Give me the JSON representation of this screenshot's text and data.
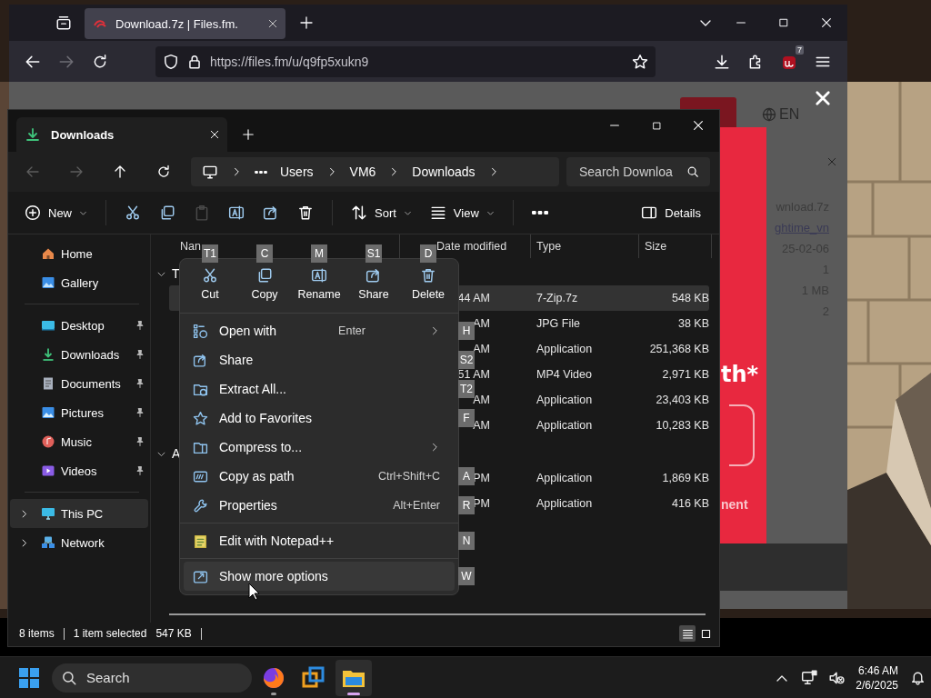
{
  "browser": {
    "tabs": [
      {
        "title": "Download.7z | Files.fm.",
        "selected": true
      }
    ],
    "url": "https://files.fm/u/q9fp5xukn9",
    "extension_badge": "7",
    "page": {
      "language": "EN",
      "popup_heading": "th*",
      "popup_link": "nent",
      "file_details": [
        "wnload.7z",
        "ghtime_vn",
        "25-02-06",
        "1",
        "1 MB",
        "2"
      ]
    }
  },
  "explorer": {
    "tabs": [
      {
        "title": "Downloads",
        "selected": true
      }
    ],
    "breadcrumb": [
      "Users",
      "VM6",
      "Downloads"
    ],
    "search": {
      "placeholder": "Search Downloa"
    },
    "toolbar": [
      {
        "kind": "new",
        "label": "New",
        "disabled": false
      },
      {
        "kind": "cut",
        "disabled": false
      },
      {
        "kind": "copy",
        "disabled": false
      },
      {
        "kind": "paste",
        "disabled": true
      },
      {
        "kind": "rename",
        "disabled": false
      },
      {
        "kind": "share",
        "disabled": false
      },
      {
        "kind": "delete",
        "disabled": false
      },
      {
        "kind": "sort",
        "label": "Sort",
        "disabled": false
      },
      {
        "kind": "view",
        "label": "View",
        "disabled": false
      },
      {
        "kind": "more",
        "disabled": false
      }
    ],
    "details_button": "Details",
    "sidebar": [
      [
        {
          "label": "Home",
          "pinned": false,
          "expandable": false,
          "selected": false
        },
        {
          "label": "Gallery",
          "pinned": false,
          "expandable": false,
          "selected": false
        }
      ],
      [
        {
          "label": "Desktop",
          "pinned": true,
          "expandable": false,
          "selected": false
        },
        {
          "label": "Downloads",
          "pinned": true,
          "expandable": false,
          "selected": false
        },
        {
          "label": "Documents",
          "pinned": true,
          "expandable": false,
          "selected": false
        },
        {
          "label": "Pictures",
          "pinned": true,
          "expandable": false,
          "selected": false
        },
        {
          "label": "Music",
          "pinned": true,
          "expandable": false,
          "selected": false
        },
        {
          "label": "Videos",
          "pinned": true,
          "expandable": false,
          "selected": false
        }
      ],
      [
        {
          "label": "This PC",
          "pinned": false,
          "expandable": true,
          "selected": true
        },
        {
          "label": "Network",
          "pinned": false,
          "expandable": true,
          "selected": false
        }
      ]
    ],
    "columns": [
      "Nan",
      "Date modified",
      "Type",
      "Size"
    ],
    "groups": [
      {
        "label": "T",
        "expanded": true,
        "rows": [
          {
            "date": "44 AM",
            "type": "7-Zip.7z",
            "size": "548 KB",
            "selected": true
          },
          {
            "date": "AM",
            "type": "JPG File",
            "size": "38 KB",
            "selected": false
          },
          {
            "date": "AM",
            "type": "Application",
            "size": "251,368 KB",
            "selected": false
          },
          {
            "date": "51 AM",
            "type": "MP4 Video",
            "size": "2,971 KB",
            "selected": false
          },
          {
            "date": "AM",
            "type": "Application",
            "size": "23,403 KB",
            "selected": false
          },
          {
            "date": "AM",
            "type": "Application",
            "size": "10,283 KB",
            "selected": false
          }
        ]
      },
      {
        "label": "A",
        "expanded": true,
        "rows": [
          {
            "date": "PM",
            "type": "Application",
            "size": "1,869 KB",
            "selected": false
          },
          {
            "date": "PM",
            "type": "Application",
            "size": "416 KB",
            "selected": false
          }
        ]
      }
    ],
    "status": {
      "item_count": "8 items",
      "selection": "1 item selected",
      "selection_size": "547 KB"
    },
    "views": [
      {
        "kind": "details",
        "selected": true
      },
      {
        "kind": "tiles",
        "selected": false
      }
    ]
  },
  "context_menu": {
    "actions": [
      {
        "label": "Cut",
        "access_key": "T1"
      },
      {
        "label": "Copy",
        "access_key": "C"
      },
      {
        "label": "Rename",
        "access_key": "M"
      },
      {
        "label": "Share",
        "access_key": "S1"
      },
      {
        "label": "Delete",
        "access_key": "D"
      }
    ],
    "items": [
      {
        "kind": "item",
        "label": "Open with",
        "shortcut": "Enter",
        "submenu": true,
        "access_key": "H",
        "selected": false
      },
      {
        "kind": "item",
        "label": "Share",
        "submenu": false,
        "access_key": "S2",
        "selected": false
      },
      {
        "kind": "item",
        "label": "Extract All...",
        "submenu": false,
        "access_key": "T2",
        "selected": false
      },
      {
        "kind": "item",
        "label": "Add to Favorites",
        "submenu": false,
        "access_key": "F",
        "selected": false
      },
      {
        "kind": "item",
        "label": "Compress to...",
        "submenu": true,
        "selected": false
      },
      {
        "kind": "item",
        "label": "Copy as path",
        "shortcut": "Ctrl+Shift+C",
        "submenu": false,
        "access_key": "A",
        "selected": false
      },
      {
        "kind": "item",
        "label": "Properties",
        "shortcut": "Alt+Enter",
        "submenu": false,
        "access_key": "R",
        "selected": false
      },
      {
        "kind": "separator"
      },
      {
        "kind": "item",
        "label": "Edit with Notepad++",
        "submenu": false,
        "access_key": "N",
        "selected": false
      },
      {
        "kind": "separator"
      },
      {
        "kind": "item",
        "label": "Show more options",
        "submenu": false,
        "access_key": "W",
        "selected": true
      }
    ]
  },
  "taskbar": {
    "search_placeholder": "Search",
    "apps": [
      {
        "kind": "browser",
        "running": true,
        "selected": false
      },
      {
        "kind": "vm",
        "running": false,
        "selected": false
      },
      {
        "kind": "files",
        "running": true,
        "selected": true
      }
    ],
    "time": "6:46 AM",
    "date": "2/6/2025"
  }
}
